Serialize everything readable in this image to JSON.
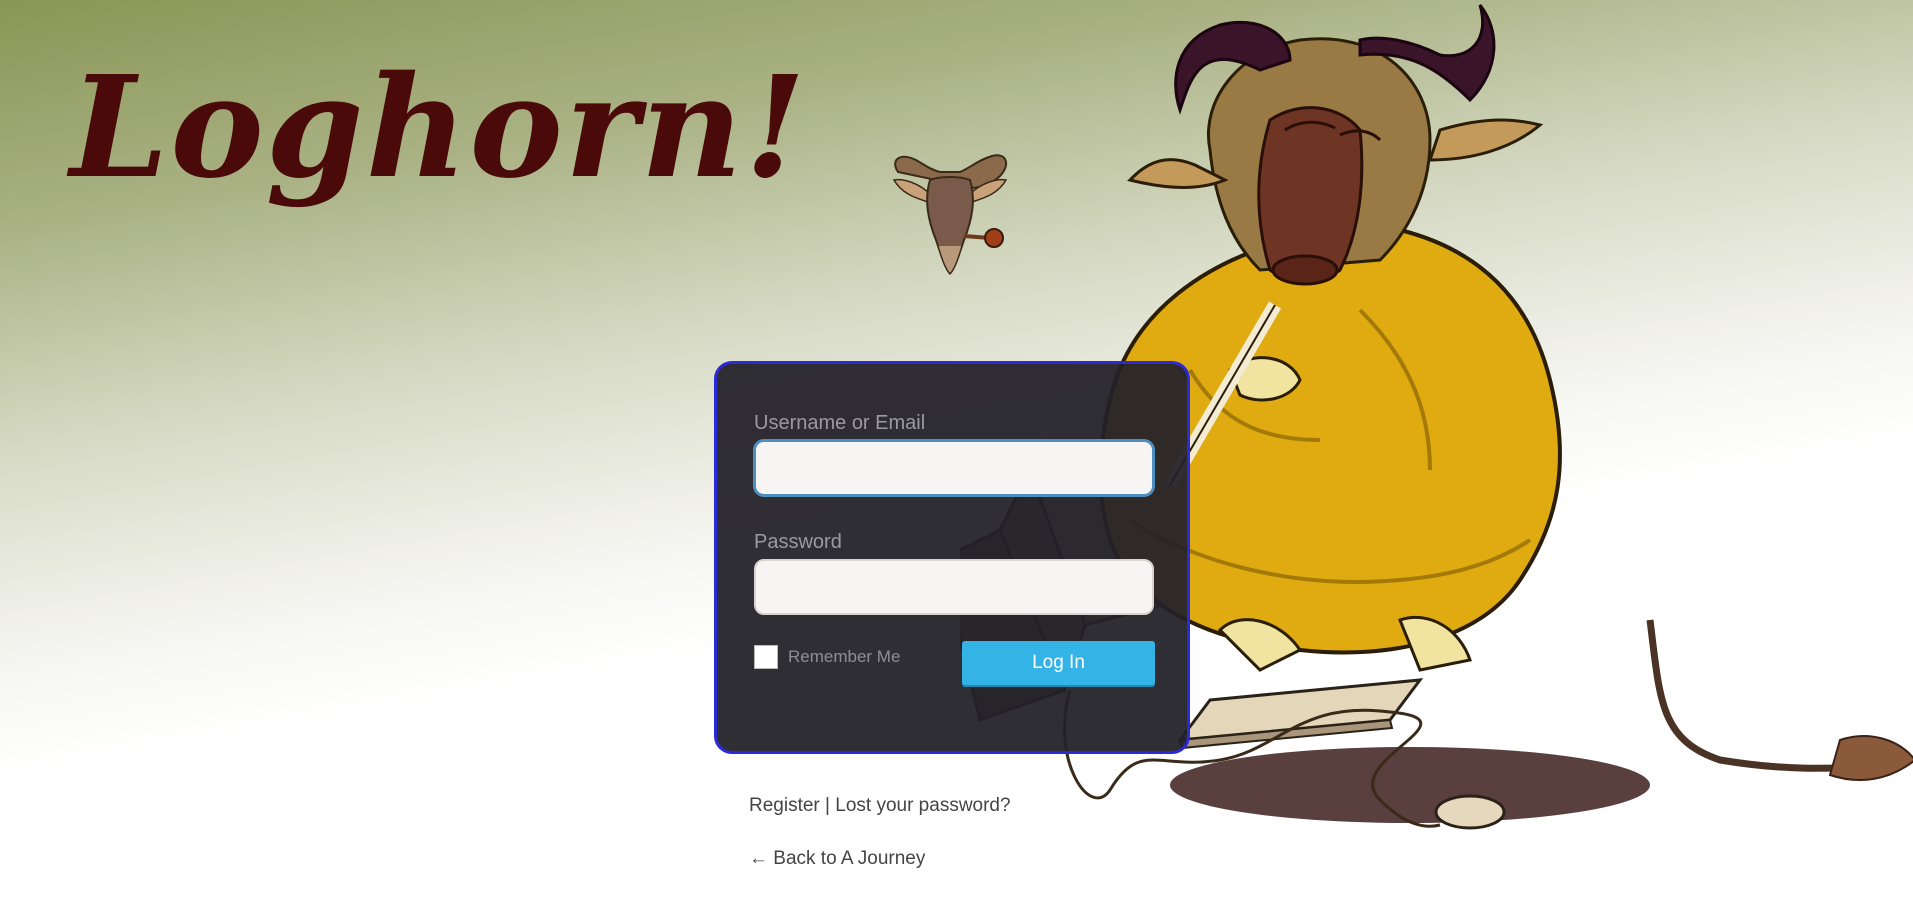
{
  "site": {
    "title": "Loghorn!"
  },
  "login_form": {
    "username_label": "Username or Email",
    "username_value": "",
    "password_label": "Password",
    "password_value": "",
    "remember_label": "Remember Me",
    "remember_checked": false,
    "submit_label": "Log In"
  },
  "nav": {
    "register": "Register",
    "separator": "|",
    "lost_password": "Lost your password?",
    "back_link": "← Back to A Journey"
  },
  "colors": {
    "title": "#4a0a0a",
    "card_bg": "#232128",
    "card_border": "#2a2ad8",
    "button": "#33b3e6"
  },
  "images": {
    "small_logo": "gnu-head-logo",
    "hero": "gnu-meditating-illustration"
  }
}
